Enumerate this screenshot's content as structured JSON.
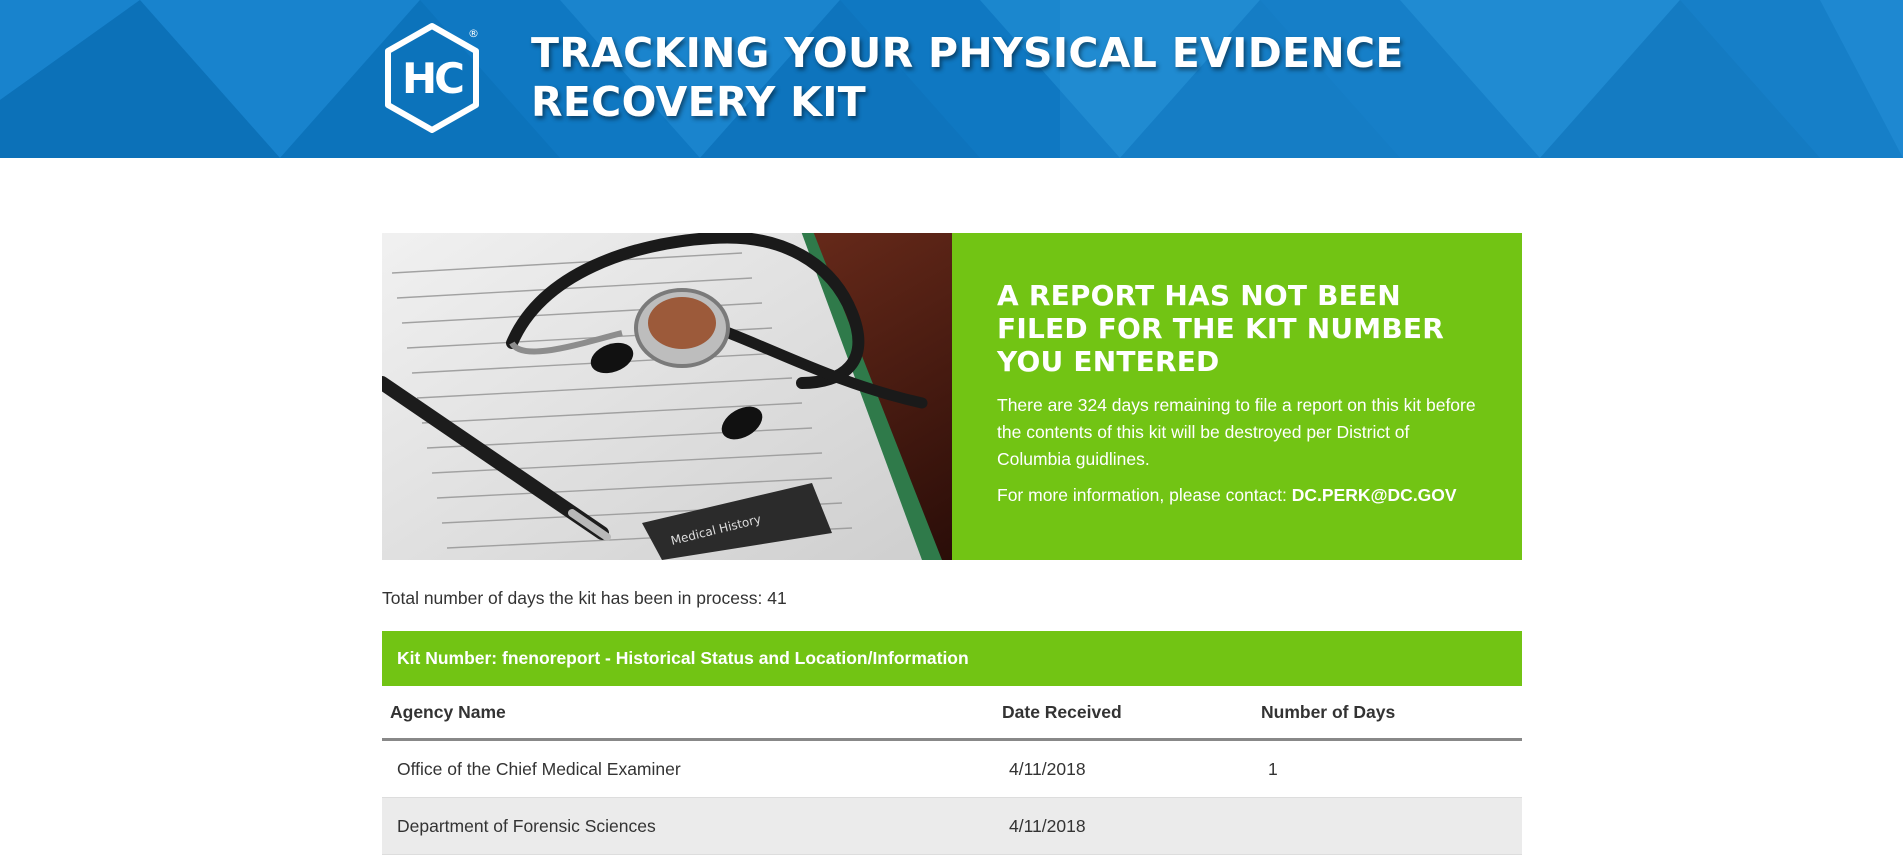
{
  "header": {
    "logo_text": "HC",
    "logo_reg": "®",
    "title_line1": "TRACKING YOUR PHYSICAL EVIDENCE",
    "title_line2": "RECOVERY KIT"
  },
  "hero": {
    "image_alt": "stethoscope on medical history clipboard",
    "clipboard_label": "Medical History",
    "title_line1": "A REPORT HAS NOT BEEN",
    "title_line2": "FILED FOR THE KIT NUMBER",
    "title_line3": "YOU ENTERED",
    "body": "There are 324 days remaining to file a report on this kit before the contents of this kit will be destroyed per District of Columbia guidlines.",
    "contact_prefix": "For more information, please contact: ",
    "contact_email": "DC.PERK@DC.GOV"
  },
  "process": {
    "label": "Total number of days the kit has been in process: ",
    "days": "41"
  },
  "kit": {
    "heading": "Kit Number: fnenoreport - Historical Status and Location/Information"
  },
  "table": {
    "columns": [
      "Agency Name",
      "Date Received",
      "Number of Days"
    ],
    "rows": [
      {
        "agency": "Office of the Chief Medical Examiner",
        "date": "4/11/2018",
        "days": "1"
      },
      {
        "agency": "Department of Forensic Sciences",
        "date": "4/11/2018",
        "days": ""
      }
    ]
  },
  "colors": {
    "header_blue": "#0f78c2",
    "accent_green": "#72c414",
    "text": "#333333",
    "row_alt": "#ebebeb"
  }
}
